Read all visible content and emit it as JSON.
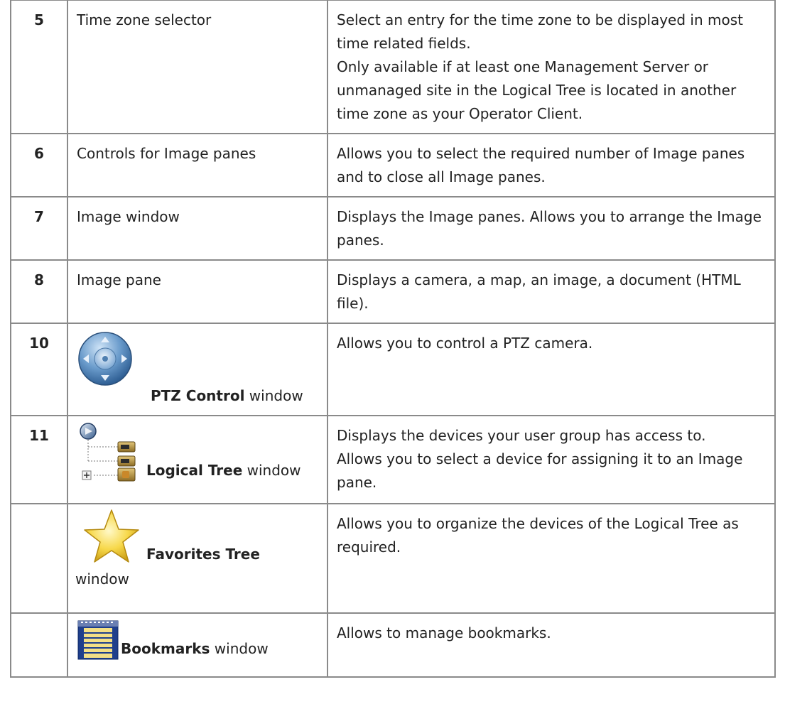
{
  "rows": [
    {
      "number": "5",
      "element": "Time zone selector",
      "description": [
        "Select an entry for the time zone to be displayed in most time related fields.",
        "Only available if at least one Management Server or unmanaged site in the Logical Tree is located in another time zone as your Operator Client."
      ]
    },
    {
      "number": "6",
      "element": "Controls for Image panes",
      "description": [
        "Allows you to select the required number of Image panes and to close all Image panes."
      ]
    },
    {
      "number": "7",
      "element": "Image window",
      "description": [
        "Displays the Image panes. Allows you to arrange the Image panes."
      ]
    },
    {
      "number": "8",
      "element": "Image pane",
      "description": [
        "Displays a camera, a map, an image, a document (HTML file)."
      ]
    },
    {
      "number": "10",
      "element_bold": "PTZ Control",
      "element_suffix": " window",
      "icon": "ptz-control-icon",
      "description": [
        "Allows you to control a PTZ camera."
      ]
    },
    {
      "number": "11",
      "element_bold": "Logical Tree",
      "element_suffix": " window",
      "icon": "logical-tree-icon",
      "description": [
        "Displays the devices your user group has access to.",
        "Allows you to select a device for assigning it to an Image pane."
      ]
    },
    {
      "number": "",
      "element_bold": "Favorites Tree",
      "element_suffix": "window",
      "icon": "star-icon",
      "description": [
        "Allows you to organize the devices of the Logical Tree as required."
      ]
    },
    {
      "number": "",
      "element_bold": "Bookmarks",
      "element_suffix": " window",
      "icon": "bookmarks-icon",
      "description": [
        "Allows to manage bookmarks."
      ]
    }
  ]
}
